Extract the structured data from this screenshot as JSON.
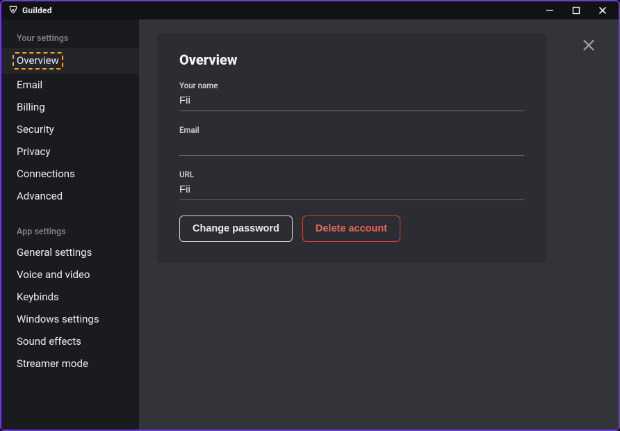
{
  "titlebar": {
    "brand": "Guilded"
  },
  "sidebar": {
    "section1_label": "Your settings",
    "items1": [
      {
        "label": "Overview",
        "active": true
      },
      {
        "label": "Email"
      },
      {
        "label": "Billing"
      },
      {
        "label": "Security"
      },
      {
        "label": "Privacy"
      },
      {
        "label": "Connections"
      },
      {
        "label": "Advanced"
      }
    ],
    "section2_label": "App settings",
    "items2": [
      {
        "label": "General settings"
      },
      {
        "label": "Voice and video"
      },
      {
        "label": "Keybinds"
      },
      {
        "label": "Windows settings"
      },
      {
        "label": "Sound effects"
      },
      {
        "label": "Streamer mode"
      }
    ]
  },
  "panel": {
    "title": "Overview",
    "fields": {
      "name_label": "Your name",
      "name_value": "Fii",
      "email_label": "Email",
      "email_value": "",
      "url_label": "URL",
      "url_value": "Fii"
    },
    "buttons": {
      "change_password": "Change password",
      "delete_account": "Delete account"
    }
  }
}
